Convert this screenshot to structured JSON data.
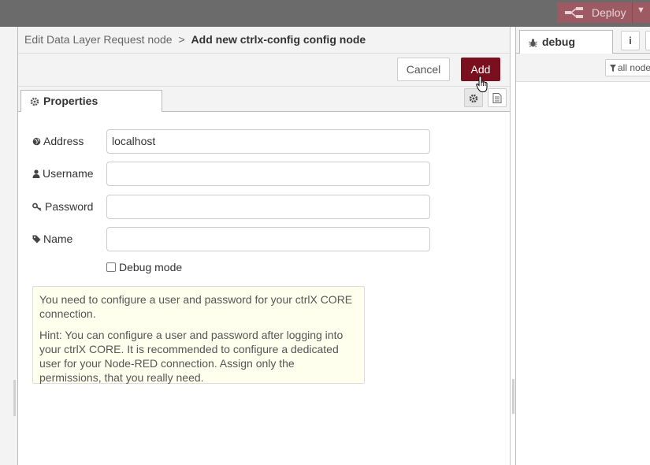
{
  "header": {
    "deploy_label": "Deploy"
  },
  "tray": {
    "breadcrumb": {
      "parent": "Edit Data Layer Request node",
      "separator": ">",
      "current": "Add new ctrlx-config config node"
    },
    "buttons": {
      "cancel": "Cancel",
      "add": "Add"
    },
    "tabs": {
      "properties": "Properties"
    }
  },
  "form": {
    "address": {
      "label": "Address",
      "value": "localhost"
    },
    "username": {
      "label": "Username",
      "value": ""
    },
    "password": {
      "label": "Password",
      "value": ""
    },
    "name": {
      "label": "Name",
      "value": ""
    },
    "debug_mode": {
      "label": "Debug mode",
      "checked": false
    }
  },
  "info": {
    "paragraph1": "You need to configure a user and password for your ctrlX CORE connection.",
    "paragraph2": "Hint: You can configure a user and password after logging into your ctrlX CORE. It is recommended to configure a dedicated user for your Node-RED connection. Assign only the permissions, that you really need."
  },
  "sidebar": {
    "tab_label": "debug",
    "info_label": "i",
    "filter_label": "all nodes"
  },
  "colors": {
    "primary": "#7a0f1e",
    "header": "#6b6b6b",
    "deploy": "#9e5a63",
    "info_bg": "#ffffee"
  }
}
